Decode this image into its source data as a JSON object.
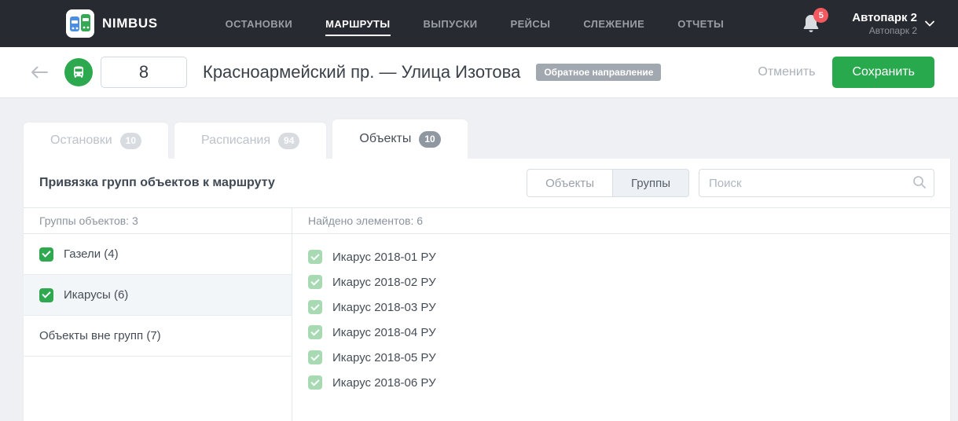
{
  "brand": {
    "name": "NIMBUS"
  },
  "nav": {
    "items": [
      {
        "label": "ОСТАНОВКИ",
        "active": false
      },
      {
        "label": "МАРШРУТЫ",
        "active": true
      },
      {
        "label": "ВЫПУСКИ",
        "active": false
      },
      {
        "label": "РЕЙСЫ",
        "active": false
      },
      {
        "label": "СЛЕЖЕНИЕ",
        "active": false
      },
      {
        "label": "ОТЧЕТЫ",
        "active": false
      }
    ]
  },
  "header_right": {
    "notification_count": "5",
    "account_name": "Автопарк 2",
    "account_sub": "Автопарк 2"
  },
  "route_bar": {
    "route_number": "8",
    "title": "Красноармейский пр. — Улица Изотова",
    "direction_badge": "Обратное направление",
    "cancel_label": "Отменить",
    "save_label": "Сохранить"
  },
  "tabs": [
    {
      "label": "Остановки",
      "count": "10",
      "active": false
    },
    {
      "label": "Расписания",
      "count": "94",
      "active": false
    },
    {
      "label": "Объекты",
      "count": "10",
      "active": true
    }
  ],
  "panel": {
    "title": "Привязка групп объектов к маршруту",
    "toggle": {
      "options": [
        "Объекты",
        "Группы"
      ],
      "active": "Группы"
    },
    "search_placeholder": "Поиск"
  },
  "groups": {
    "header": "Группы объектов: 3",
    "items": [
      {
        "label": "Газели (4)",
        "checked": true,
        "selected": false
      },
      {
        "label": "Икарусы (6)",
        "checked": true,
        "selected": true
      },
      {
        "label": "Объекты вне групп (7)",
        "checked": false,
        "selected": false
      }
    ]
  },
  "elements": {
    "header": "Найдено элементов: 6",
    "items": [
      "Икарус 2018-01 РУ",
      "Икарус 2018-02 РУ",
      "Икарус 2018-03 РУ",
      "Икарус 2018-04 РУ",
      "Икарус 2018-05 РУ",
      "Икарус 2018-06 РУ"
    ]
  },
  "colors": {
    "topbar_bg": "#272a31",
    "accent_green": "#28a94d",
    "notification_red": "#f3595f",
    "badge_gray": "#a2a8af",
    "selected_row_bg": "#f3f6f9",
    "checked_muted_green": "#a7dab2",
    "page_bg": "#eef0f4"
  }
}
